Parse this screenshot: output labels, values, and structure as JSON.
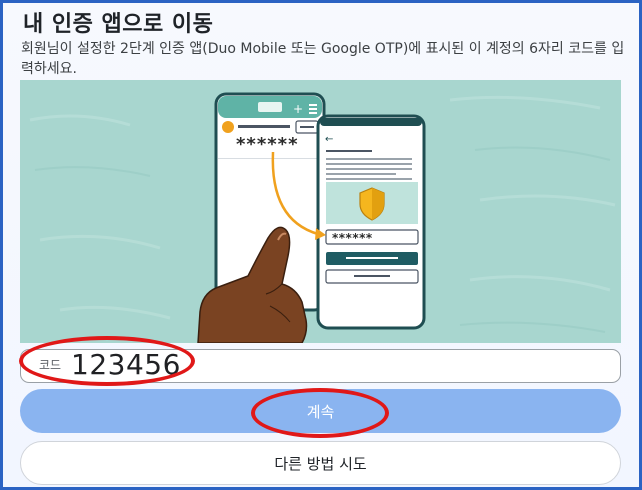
{
  "header": {
    "title": "내 인증 앱으로 이동",
    "description": "회원님이 설정한 2단계 인증 앱(Duo Mobile 또는 Google OTP)에 표시된 이 계정의 6자리 코드를 입력하세요."
  },
  "illustration": {
    "masked_code": "******"
  },
  "code_input": {
    "label": "코드",
    "value": "123456"
  },
  "buttons": {
    "continue_label": "계속",
    "other_method_label": "다른 방법 시도"
  },
  "colors": {
    "frame_border": "#2b63c3",
    "illustration_bg": "#a8d6cf",
    "continue_button": "#8ab4f0",
    "annotation": "#e01818"
  }
}
